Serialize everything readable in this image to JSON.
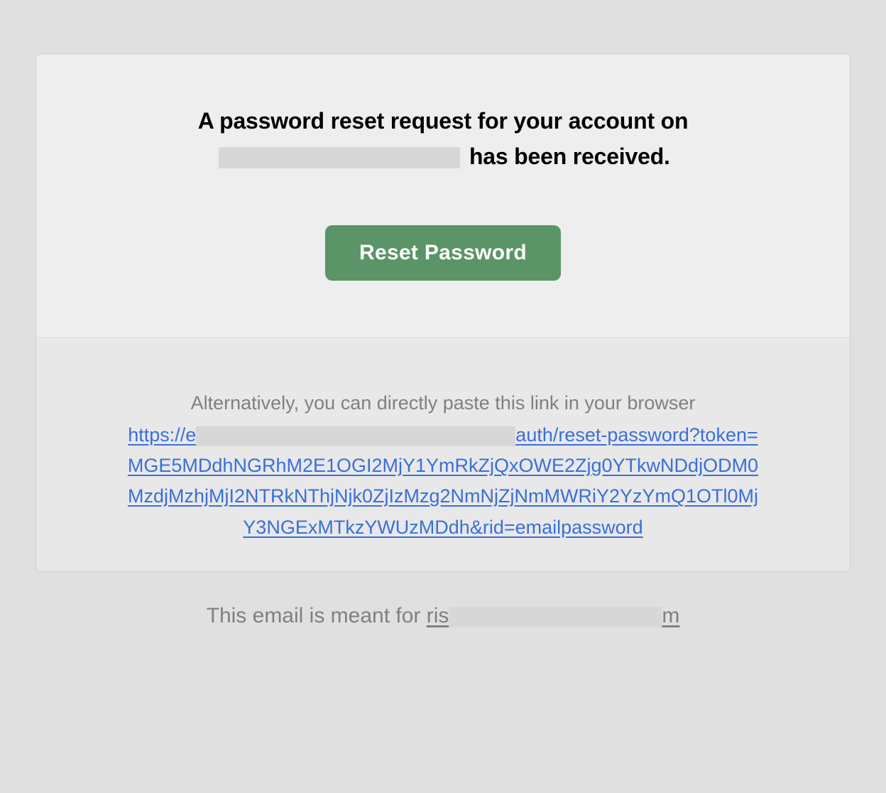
{
  "headline": {
    "prefix": "A password reset request for your account on",
    "suffix": "has been received."
  },
  "button": {
    "label": "Reset Password"
  },
  "alternative": {
    "label": "Alternatively, you can directly paste this link in your browser",
    "link_prefix": "https://e",
    "link_suffix": "auth/reset-password?token=MGE5MDdhNGRhM2E1OGI2MjY1YmRkZjQxOWE2Zjg0YTkwNDdjODM0MzdjMzhjMjI2NTRkNThjNjk0ZjIzMzg2NmNjZjNmMWRiY2YzYmQ1OTl0MjY3NGExMTkzYWUzMDdh&rid=emailpassword"
  },
  "footer": {
    "prefix": "This email is meant for ",
    "email_prefix": "ris",
    "email_suffix": "m"
  }
}
